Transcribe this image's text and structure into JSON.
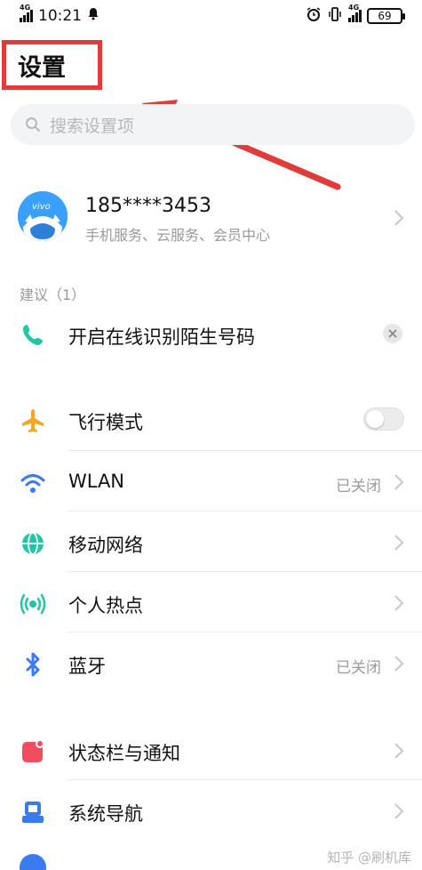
{
  "status_bar": {
    "time": "10:21",
    "network_left": "4G",
    "network_right": "4G",
    "battery": "69"
  },
  "header": {
    "title": "设置"
  },
  "search": {
    "placeholder": "搜索设置项"
  },
  "account": {
    "name": "185****3453",
    "subtitle": "手机服务、云服务、会员中心",
    "brand": "vivo"
  },
  "suggestions": {
    "label": "建议（1）",
    "item": "开启在线识别陌生号码"
  },
  "settings": [
    {
      "label": "飞行模式",
      "icon": "airplane-icon"
    },
    {
      "label": "WLAN",
      "status": "已关闭",
      "icon": "wifi-icon"
    },
    {
      "label": "移动网络",
      "icon": "globe-icon"
    },
    {
      "label": "个人热点",
      "icon": "hotspot-icon"
    },
    {
      "label": "蓝牙",
      "status": "已关闭",
      "icon": "bluetooth-icon"
    },
    {
      "label": "状态栏与通知",
      "icon": "notification-icon"
    },
    {
      "label": "系统导航",
      "icon": "navigation-icon"
    }
  ],
  "watermark": "知乎 @刷机库",
  "colors": {
    "annotation_red": "#e23b3b",
    "accent_green": "#1fc7a6",
    "accent_blue": "#3a7bf0",
    "airplane_orange": "#f5a623",
    "notification_red": "#f04e5e"
  }
}
